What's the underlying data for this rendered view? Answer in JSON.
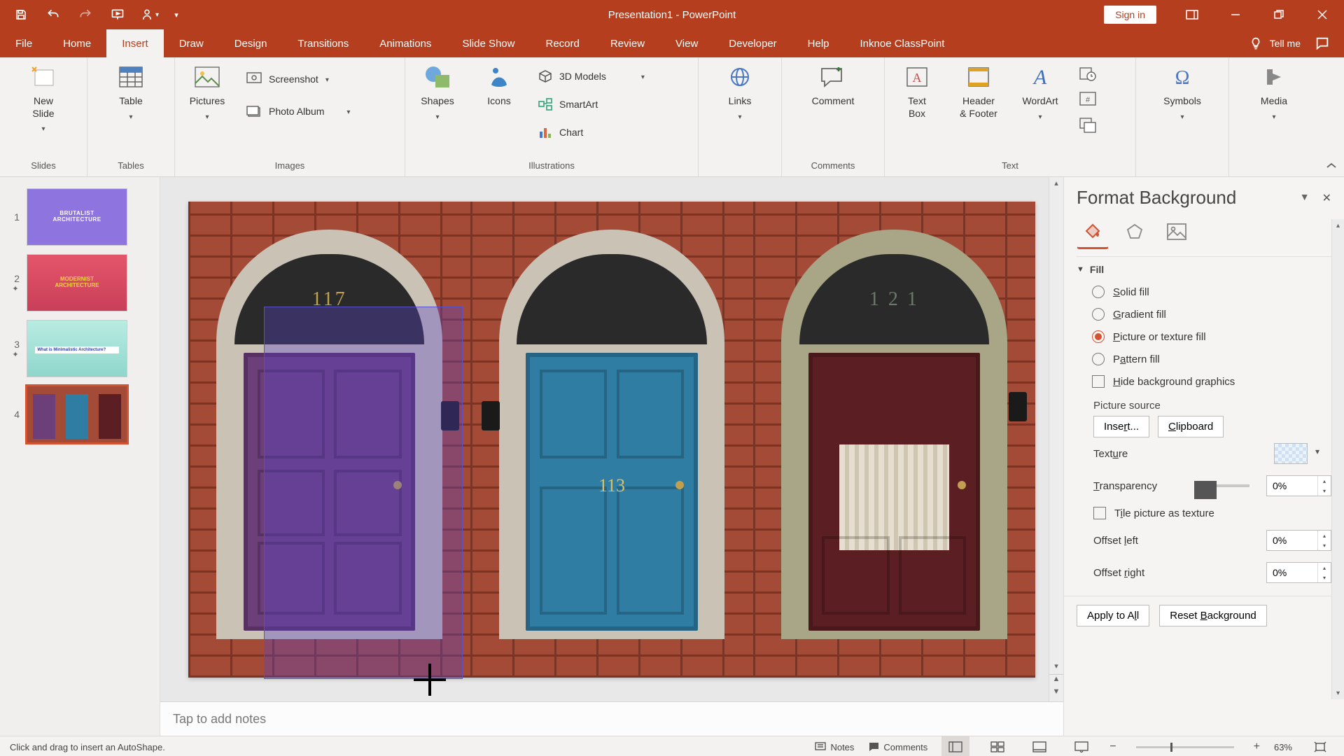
{
  "title": "Presentation1  -  PowerPoint",
  "signin": "Sign in",
  "tabs": [
    "File",
    "Home",
    "Insert",
    "Draw",
    "Design",
    "Transitions",
    "Animations",
    "Slide Show",
    "Record",
    "Review",
    "View",
    "Developer",
    "Help",
    "Inknoe ClassPoint"
  ],
  "active_tab": "Insert",
  "tellme": "Tell me",
  "ribbon": {
    "slides": {
      "label": "Slides",
      "new_slide": "New\nSlide"
    },
    "tables": {
      "label": "Tables",
      "table": "Table"
    },
    "images": {
      "label": "Images",
      "pictures": "Pictures",
      "screenshot": "Screenshot",
      "photo_album": "Photo Album"
    },
    "illus": {
      "label": "Illustrations",
      "shapes": "Shapes",
      "icons": "Icons",
      "models": "3D Models",
      "smartart": "SmartArt",
      "chart": "Chart"
    },
    "links": {
      "label": "",
      "links": "Links"
    },
    "comments": {
      "label": "Comments",
      "comment": "Comment"
    },
    "text": {
      "label": "Text",
      "textbox": "Text\nBox",
      "header": "Header\n& Footer",
      "wordart": "WordArt"
    },
    "symbols": {
      "label": "",
      "symbols": "Symbols"
    },
    "media": {
      "label": "",
      "media": "Media"
    }
  },
  "thumbs": [
    {
      "n": "1",
      "title": "BRUTALIST\nARCHITECTURE",
      "bg": "#8E74DE",
      "fg": "#fff"
    },
    {
      "n": "2",
      "title": "MODERNIST\nARCHITECTURE",
      "bg": "#E4556A",
      "fg": "#F6D248",
      "anim": true
    },
    {
      "n": "3",
      "title": "What is Minimalistic Architecture?",
      "bg": "#B9ECE3",
      "fg": "#2E3FA6",
      "anim": true
    },
    {
      "n": "4",
      "title": "",
      "bg": "#fff",
      "fg": "#000",
      "doors": true
    }
  ],
  "selected_thumb": 4,
  "doors": [
    {
      "transom": "117",
      "door": "#6C3E7A",
      "label_pos": "none"
    },
    {
      "transom": "",
      "door": "#2F7DA3",
      "label": "113",
      "label_pos": "mid"
    },
    {
      "transom": "1 2 1",
      "door": "#5B1E22",
      "curtain": true
    }
  ],
  "notes_placeholder": "Tap to add notes",
  "pane": {
    "title": "Format Background",
    "fill_head": "Fill",
    "solid": "Solid fill",
    "gradient": "Gradient fill",
    "picture": "Picture or texture fill",
    "pattern": "Pattern fill",
    "hidebg": "Hide background graphics",
    "picsrc": "Picture source",
    "insert": "Insert...",
    "clipboard": "Clipboard",
    "texture": "Texture",
    "transparency": "Transparency",
    "transparency_val": "0%",
    "tile": "Tile picture as texture",
    "offleft": "Offset left",
    "offleft_val": "0%",
    "offright": "Offset right",
    "offright_val": "0%",
    "apply": "Apply to All",
    "reset": "Reset Background"
  },
  "status": {
    "msg": "Click and drag to insert an AutoShape.",
    "notes": "Notes",
    "comments": "Comments",
    "zoom": "63%"
  }
}
